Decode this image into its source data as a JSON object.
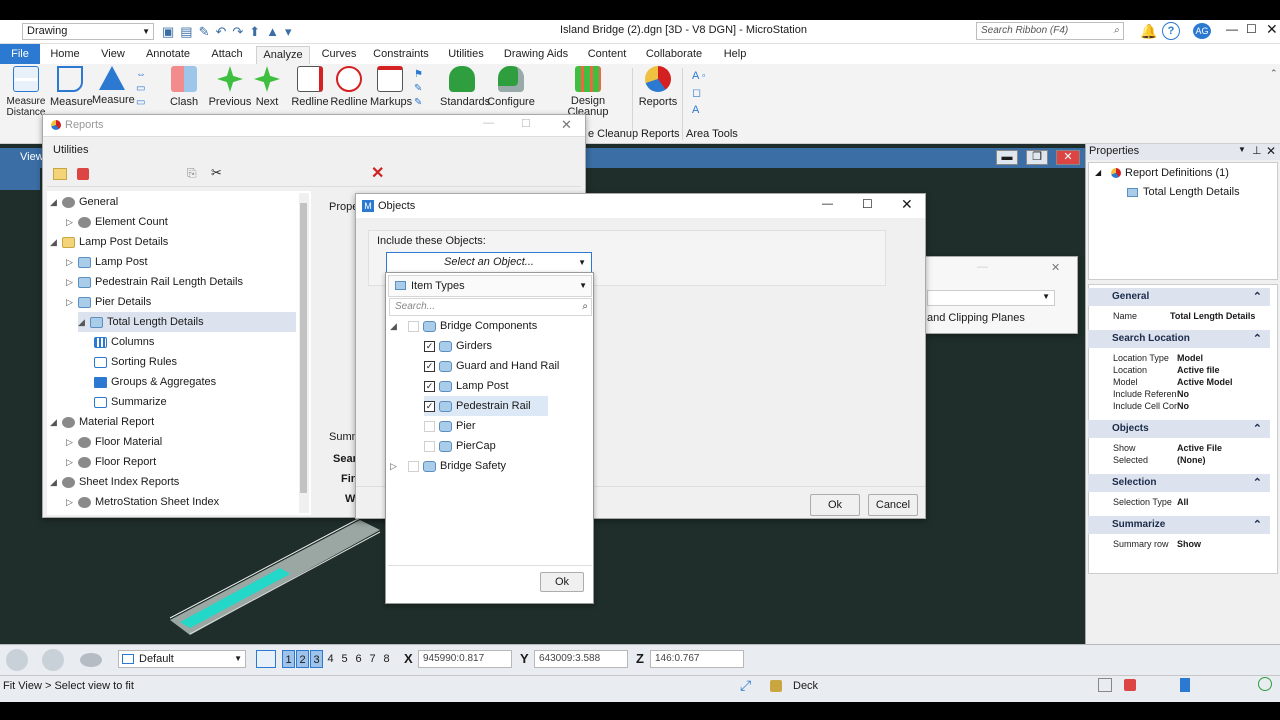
{
  "app": {
    "workflow": "Drawing",
    "title": "Island Bridge (2).dgn [3D - V8 DGN] - MicroStation",
    "search_placeholder": "Search Ribbon (F4)",
    "user_initials": "AG"
  },
  "ribbon_tabs": [
    "File",
    "Home",
    "View",
    "Annotate",
    "Attach",
    "Analyze",
    "Curves",
    "Constraints",
    "Utilities",
    "Drawing Aids",
    "Content",
    "Collaborate",
    "Help"
  ],
  "ribbon": {
    "buttons": [
      "Measure Distance",
      "Measure",
      "Measure",
      "Clash",
      "Previous",
      "Next",
      "Redline",
      "Redline",
      "Markups",
      "Standards",
      "Configure",
      "Design Cleanup",
      "Reports"
    ],
    "groups": [
      "e Cleanup",
      "Reports",
      "Area Tools"
    ]
  },
  "reports_window": {
    "title": "Reports",
    "utilities_label": "Utilities",
    "prope_stub": "Prope",
    "summ_stub": "Summ",
    "sear_stub": "Sear",
    "fin_stub": "Fin",
    "w_stub": "W",
    "tree": [
      {
        "label": "General",
        "level": 0,
        "icon": "gear-icon",
        "expand": "open"
      },
      {
        "label": "Element Count",
        "level": 1,
        "icon": "gear-icon",
        "expand": "closed"
      },
      {
        "label": "Lamp Post Details",
        "level": 0,
        "icon": "folder-icon",
        "expand": "open"
      },
      {
        "label": "Lamp Post",
        "level": 1,
        "icon": "cube-icon",
        "expand": "closed"
      },
      {
        "label": "Pedestrain Rail Length Details",
        "level": 1,
        "icon": "cube-icon",
        "expand": "closed"
      },
      {
        "label": "Pier Details",
        "level": 1,
        "icon": "cube-icon",
        "expand": "closed"
      },
      {
        "label": "Total Length Details",
        "level": 1,
        "icon": "cube-icon",
        "expand": "open",
        "selected": true
      },
      {
        "label": "Columns",
        "level": 2,
        "icon": "columns-icon",
        "expand": "none"
      },
      {
        "label": "Sorting Rules",
        "level": 2,
        "icon": "sort-icon",
        "expand": "none"
      },
      {
        "label": "Groups & Aggregates",
        "level": 2,
        "icon": "groups-icon",
        "expand": "none"
      },
      {
        "label": "Summarize",
        "level": 2,
        "icon": "sigma-icon",
        "expand": "none"
      },
      {
        "label": "Material Report",
        "level": 0,
        "icon": "gear-icon",
        "expand": "open"
      },
      {
        "label": "Floor Material",
        "level": 1,
        "icon": "gear-icon",
        "expand": "closed"
      },
      {
        "label": "Floor Report",
        "level": 1,
        "icon": "gear-icon",
        "expand": "closed"
      },
      {
        "label": "Sheet Index Reports",
        "level": 0,
        "icon": "gear-icon",
        "expand": "open"
      },
      {
        "label": "MetroStation Sheet Index",
        "level": 1,
        "icon": "gear-icon",
        "expand": "closed"
      }
    ]
  },
  "objects_dialog": {
    "title": "Objects",
    "include_label": "Include these Objects:",
    "select_placeholder": "Select an Object...",
    "ok": "Ok",
    "cancel": "Cancel",
    "dropdown": {
      "type_label": "Item Types",
      "search_placeholder": "Search...",
      "ok": "Ok",
      "items": [
        {
          "label": "Bridge Components",
          "level": 0,
          "checked": false,
          "expand": "open"
        },
        {
          "label": "Girders",
          "level": 1,
          "checked": true
        },
        {
          "label": "Guard and Hand Rail",
          "level": 1,
          "checked": true
        },
        {
          "label": "Lamp Post",
          "level": 1,
          "checked": true
        },
        {
          "label": "Pedestrain Rail",
          "level": 1,
          "checked": true,
          "highlight": true
        },
        {
          "label": "Pier",
          "level": 1,
          "checked": false
        },
        {
          "label": "PierCap",
          "level": 1,
          "checked": false
        },
        {
          "label": "Bridge Safety",
          "level": 0,
          "checked": false,
          "expand": "closed"
        }
      ]
    }
  },
  "side_dialog": {
    "text": "and Clipping Planes"
  },
  "view_label": "View",
  "properties": {
    "title": "Properties",
    "tree_root": "Report Definitions (1)",
    "tree_child": "Total Length Details",
    "sections": [
      {
        "name": "General",
        "rows": [
          {
            "k": "Name",
            "v": "Total Length Details"
          }
        ]
      },
      {
        "name": "Search Location",
        "rows": [
          {
            "k": "Location Type",
            "v": "Model"
          },
          {
            "k": "Location",
            "v": "Active file"
          },
          {
            "k": "Model",
            "v": "Active Model"
          },
          {
            "k": "Include Referen",
            "v": "No"
          },
          {
            "k": "Include Cell Cor",
            "v": "No"
          }
        ]
      },
      {
        "name": "Objects",
        "rows": [
          {
            "k": "Show",
            "v": "Active File"
          },
          {
            "k": "Selected",
            "v": "(None)"
          }
        ]
      },
      {
        "name": "Selection",
        "rows": [
          {
            "k": "Selection Type",
            "v": "All"
          }
        ]
      },
      {
        "name": "Summarize",
        "rows": [
          {
            "k": "Summary row",
            "v": "Show"
          }
        ]
      }
    ]
  },
  "statusbar": {
    "view_group": "Default",
    "views": [
      "1",
      "2",
      "3",
      "4",
      "5",
      "6",
      "7",
      "8"
    ],
    "x_label": "X",
    "x_value": "945990:0.817",
    "y_label": "Y",
    "y_value": "643009:3.588",
    "z_label": "Z",
    "z_value": "146:0.767",
    "prompt": "Fit View > Select view to fit",
    "level": "Deck"
  },
  "colors": {
    "accent": "#2b79d0",
    "ribbon_bg": "#f3f3f3",
    "viewport": "#1f2e2a",
    "section_bg": "#dde3ee"
  }
}
